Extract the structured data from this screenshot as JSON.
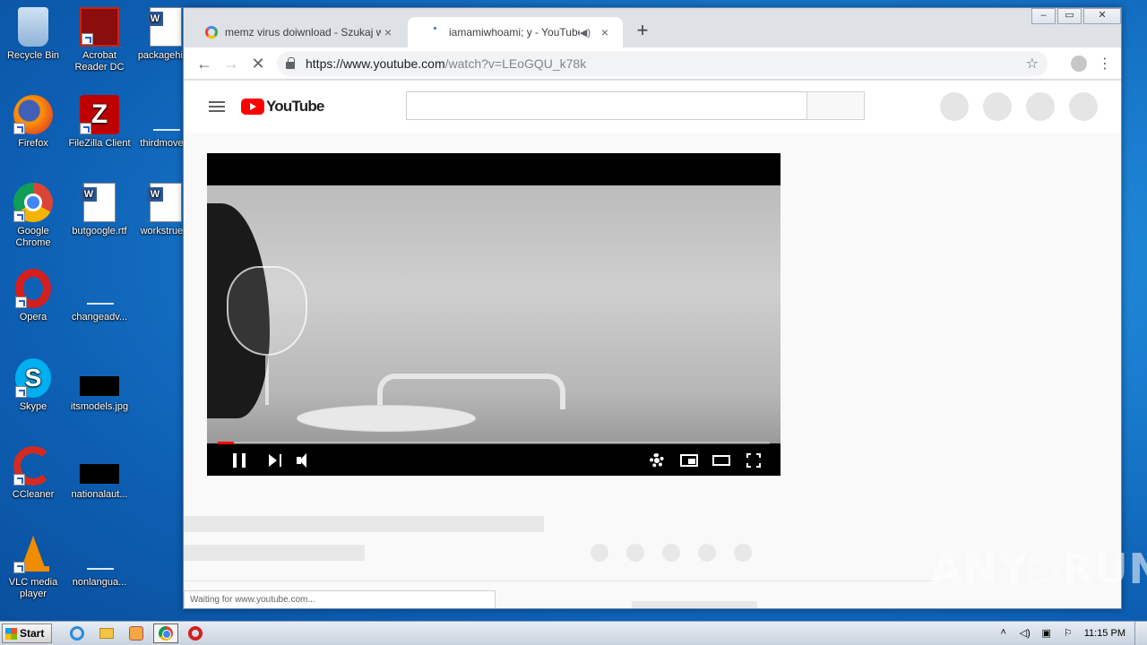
{
  "desktop": {
    "icons": [
      {
        "label": "Recycle Bin",
        "icon": "recycle-bin-icon"
      },
      {
        "label": "Acrobat Reader DC",
        "icon": "acrobat-icon"
      },
      {
        "label": "packagehir...",
        "icon": "word-doc-icon"
      },
      {
        "label": "Firefox",
        "icon": "firefox-icon"
      },
      {
        "label": "FileZilla Client",
        "icon": "filezilla-icon"
      },
      {
        "label": "thirdmove...",
        "icon": "blank-file-icon"
      },
      {
        "label": "Google Chrome",
        "icon": "chrome-icon"
      },
      {
        "label": "butgoogle.rtf",
        "icon": "word-doc-icon"
      },
      {
        "label": "workstrue...",
        "icon": "word-doc-icon"
      },
      {
        "label": "Opera",
        "icon": "opera-icon"
      },
      {
        "label": "changeadv...",
        "icon": "blank-file-icon"
      },
      {
        "label": "Skype",
        "icon": "skype-icon"
      },
      {
        "label": "itsmodels.jpg",
        "icon": "image-file-icon"
      },
      {
        "label": "CCleaner",
        "icon": "ccleaner-icon"
      },
      {
        "label": "nationalaut...",
        "icon": "image-file-icon"
      },
      {
        "label": "VLC media player",
        "icon": "vlc-icon"
      },
      {
        "label": "nonlangua...",
        "icon": "blank-file-icon"
      }
    ]
  },
  "browser": {
    "tabs": [
      {
        "title": "memz virus doiwnload - Szukaj w Goo",
        "close": "×"
      },
      {
        "title": "iamamiwhoami; y - YouTube",
        "close": "×"
      }
    ],
    "new_tab": "+",
    "window_controls": {
      "minimize": "–",
      "maximize": "▭",
      "close": "✕"
    },
    "nav": {
      "back": "←",
      "forward": "→",
      "stop": "✕"
    },
    "url_main": "https://www.youtube.com",
    "url_rest": "/watch?v=LEoGQU_k78k",
    "bookmark_star": "☆",
    "menu": "⋮",
    "status_text": "Waiting for www.youtube.com..."
  },
  "youtube": {
    "logo_text": "YouTube",
    "progress": 0.03
  },
  "watermark": "ANY▷RUN",
  "taskbar": {
    "start_label": "Start",
    "clock": "11:15 PM",
    "tray_arrow": "˄"
  },
  "colors": {
    "youtube_red": "#ff0000",
    "desktop_blue": "#1b7ed0"
  }
}
